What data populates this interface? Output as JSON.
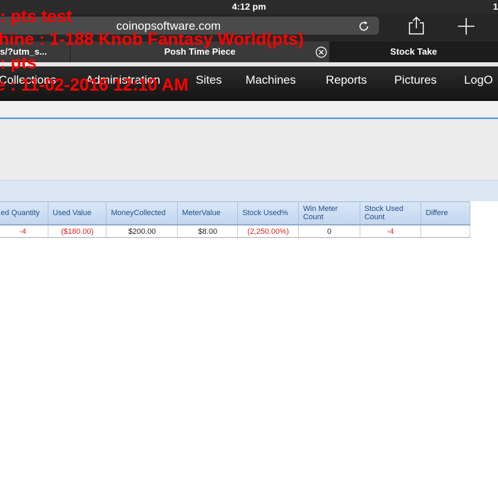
{
  "status_bar": {
    "time": "4:12 pm",
    "right_fragment": "1"
  },
  "browser": {
    "url": "coinopsoftware.com",
    "tabs": [
      {
        "label": "s/?utm_s..."
      },
      {
        "label": "Posh Time Piece"
      },
      {
        "label": "Stock Take"
      }
    ]
  },
  "nav": {
    "items": [
      {
        "label": "Collections"
      },
      {
        "label": "Administration"
      },
      {
        "label": "Sites"
      },
      {
        "label": "Machines"
      },
      {
        "label": "Reports"
      },
      {
        "label": "Pictures"
      },
      {
        "label": "LogO"
      }
    ]
  },
  "table": {
    "columns": [
      "ed Quantity",
      "Used Value",
      "MoneyCollected",
      "MeterValue",
      "Stock Used%",
      "Win Meter Count",
      "Stock Used Count",
      "Differe"
    ],
    "rows": [
      {
        "cells": [
          "-4",
          "($180.00)",
          "$200.00",
          "$8.00",
          "(2,250.00%)",
          "0",
          "-4",
          ""
        ]
      }
    ]
  },
  "overlay": {
    "line1": ": pts test",
    "line2": "hine : 1-188 Knob Fantasy World(pts)",
    "line3": ": pts",
    "line4": "e : 11-02-2016 12:10 AM"
  },
  "colors": {
    "overlay": "#ff0000",
    "negative_value": "#e02020",
    "header_text": "#1f4e8c",
    "accent_line": "#4a90e2"
  }
}
